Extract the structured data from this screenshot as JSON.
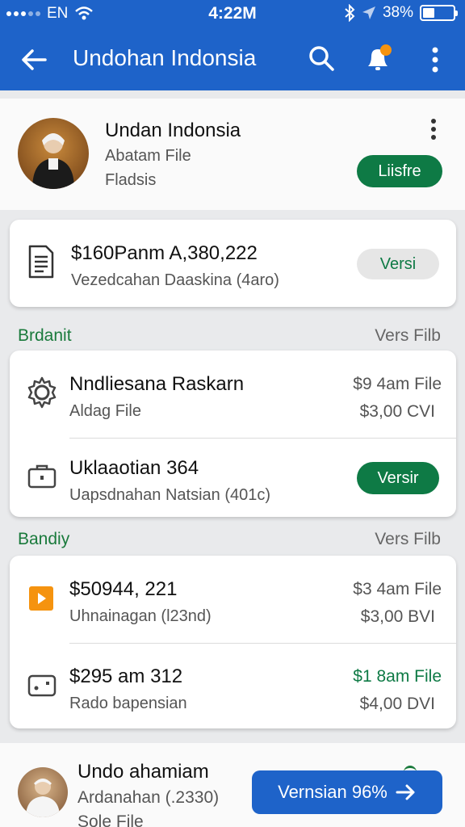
{
  "status_bar": {
    "carrier": "EN",
    "time": "4:22M",
    "battery_text": "38%",
    "battery_level": 0.38
  },
  "app_bar": {
    "title": "Undohan Indonsia"
  },
  "profile": {
    "name": "Undan Indonsia",
    "line1": "Abatam File",
    "line2": "Fladsis",
    "button": "Liisfre"
  },
  "summary_card": {
    "amount": "$160Panm A,380,222",
    "subtitle": "Vezedcahan Daaskina (4aro)",
    "button": "Versi"
  },
  "section1": {
    "label": "Brdanit",
    "right": "Vers Filb",
    "items": [
      {
        "title": "Nndliesana Raskarn",
        "subtitle": "Aldag File",
        "right1": "$9 4am File",
        "right2": "$3,00 CVI",
        "icon": "gear-icon"
      },
      {
        "title": "Uklaaotian 364",
        "subtitle": "Uapsdnahan Natsian (401c)",
        "button": "Versir",
        "icon": "briefcase-icon"
      }
    ]
  },
  "section2": {
    "label": "Bandiy",
    "right": "Vers Filb",
    "items": [
      {
        "title": "$50944, 221",
        "subtitle": "Uhnainagan (l23nd)",
        "right1": "$3 4am File",
        "right2": "$3,00 BVI",
        "icon": "play-icon"
      },
      {
        "title": "$295 am 312",
        "subtitle": "Rado bapensian",
        "right1": "$1 8am File",
        "right2": "$4,00 DVI",
        "icon": "device-icon"
      }
    ]
  },
  "bottom_bar": {
    "name": "Undo ahamiam",
    "line1": "Ardanahan (.2330)",
    "line2": "Sole File",
    "button": "Vernsian 96%"
  },
  "colors": {
    "primary": "#1e63c9",
    "green": "#0e7a45",
    "orange": "#f5930f"
  }
}
